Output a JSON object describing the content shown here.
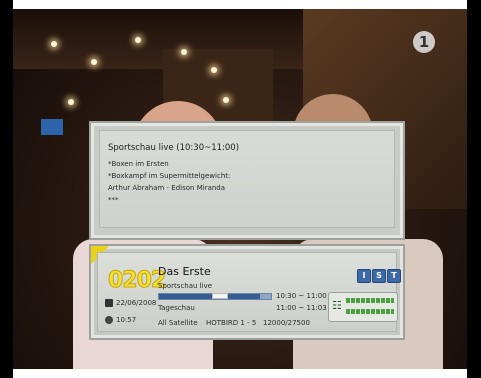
{
  "channel_logo": {
    "text": "1"
  },
  "epg": {
    "title": "Sportschau live (10:30~11:00)",
    "lines": [
      "*Boxen im Ersten",
      "*Boxkampf im Supermittelgewicht:",
      "Arthur Abraham - Edison Miranda",
      "***"
    ]
  },
  "infobar": {
    "channel_number": "0202",
    "channel_name": "Das Erste",
    "date": "22/06/2008",
    "time": "10:57",
    "current_program": "Sportschau live",
    "current_time": "10:30 ~ 11:00",
    "next_program": "Tageschau",
    "next_time": "11:00 ~ 11:03",
    "satellite_label": "All Satellite",
    "transponder": "HOTBIRD 1 - 5",
    "frequency": "12000/27500",
    "progress_fraction": 0.9,
    "icons": [
      "info-icon",
      "subtitle-icon",
      "teletext-icon"
    ],
    "icon_glyphs": [
      "I",
      "S",
      "T"
    ],
    "accent_color": "#f3df3a",
    "bar_color": "#365d93"
  }
}
